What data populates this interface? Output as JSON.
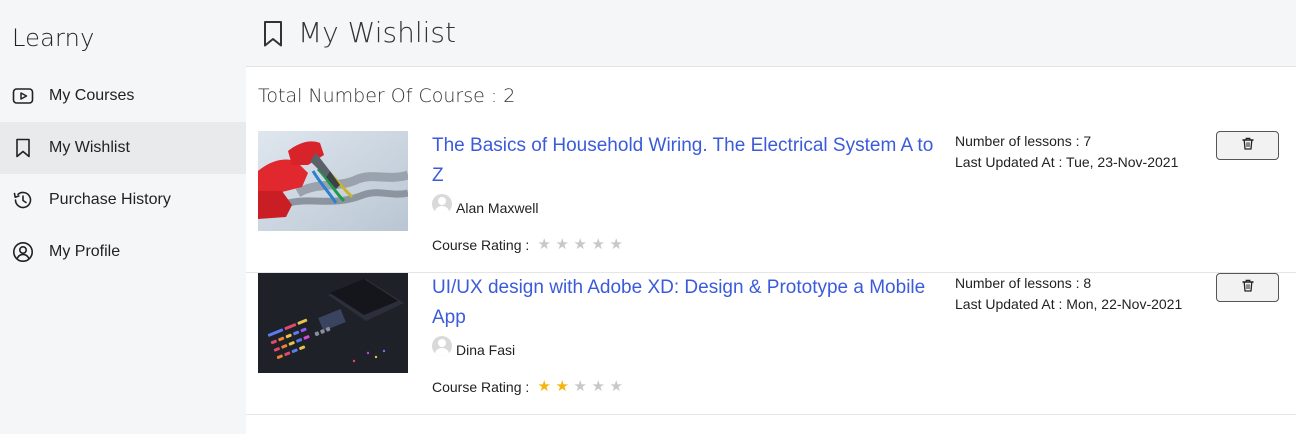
{
  "app": {
    "brand": "Learny"
  },
  "sidebar": {
    "items": [
      {
        "label": "My Courses",
        "icon": "play-icon",
        "active": false
      },
      {
        "label": "My Wishlist",
        "icon": "bookmark-icon",
        "active": true
      },
      {
        "label": "Purchase History",
        "icon": "history-icon",
        "active": false
      },
      {
        "label": "My Profile",
        "icon": "user-circle-icon",
        "active": false
      }
    ]
  },
  "header": {
    "title": "My Wishlist",
    "icon": "bookmark-icon"
  },
  "summary": {
    "total_text": "Total Number Of Course : 2"
  },
  "courses": [
    {
      "title": "The Basics of Household Wiring. The Electrical System A to Z",
      "author": "Alan Maxwell",
      "rating_label": "Course Rating :",
      "rating": 0,
      "lessons": "Number of lessons : 7",
      "updated": "Last Updated At : Tue, 23-Nov-2021",
      "thumbnail": "electrical-wiring-thumbnail"
    },
    {
      "title": "UI/UX design with Adobe XD: Design & Prototype a Mobile App",
      "author": "Dina Fasi",
      "rating_label": "Course Rating :",
      "rating": 2,
      "lessons": "Number of lessons : 8",
      "updated": "Last Updated At : Mon, 22-Nov-2021",
      "thumbnail": "ui-ux-design-thumbnail"
    }
  ],
  "colors": {
    "link": "#3b5bdb",
    "star_filled": "#f5b50a",
    "star_empty": "#c8c8c8",
    "sidebar_bg": "#f5f6f8",
    "active_bg": "#e9eaec"
  }
}
